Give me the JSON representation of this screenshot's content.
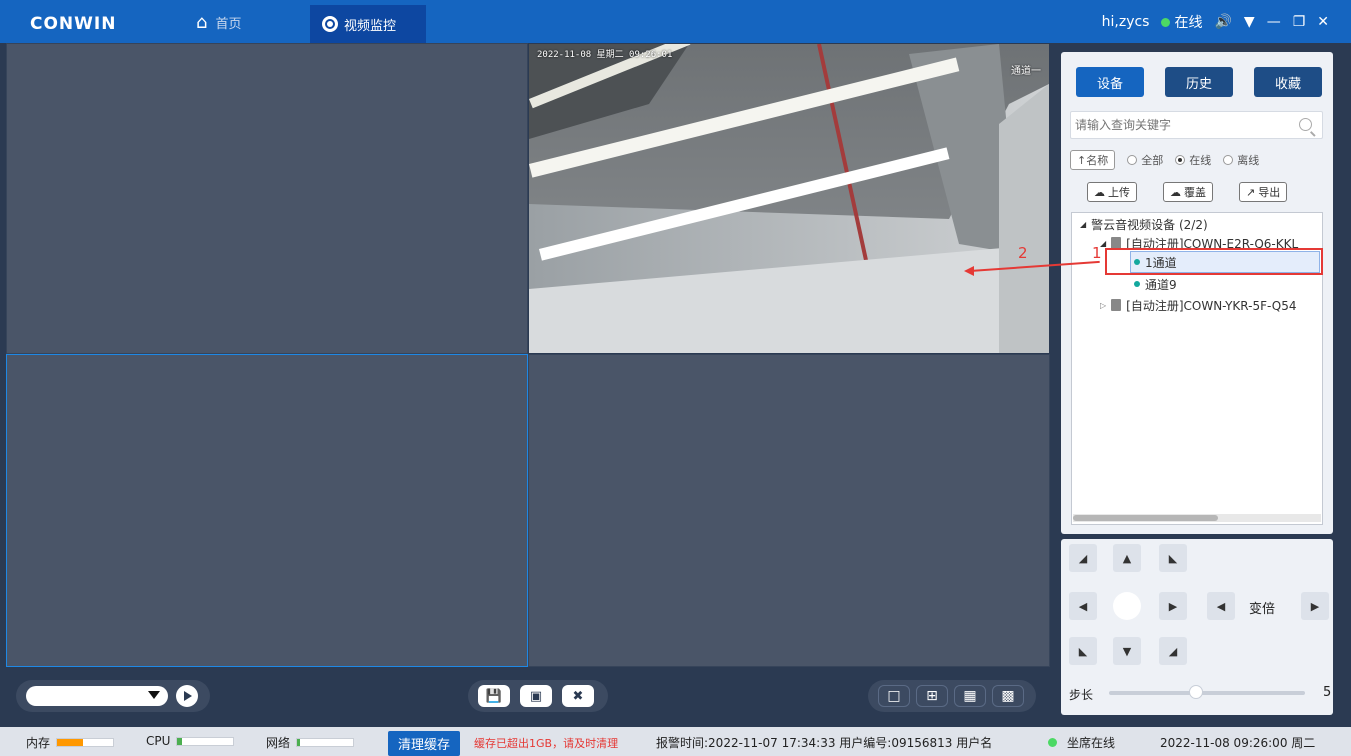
{
  "app": {
    "logo": "CONWIN"
  },
  "nav": {
    "home_label": "首页",
    "monitor_label": "视频监控"
  },
  "window": {
    "user": "hi,zycs",
    "online_status": "在线"
  },
  "camera": {
    "osd_datetime": "2022-11-08 星期二 09:26:01",
    "osd_name": "通道一"
  },
  "toolbar": {
    "channel_select_value": ""
  },
  "sidebar": {
    "tabs": [
      "设备",
      "历史",
      "收藏"
    ],
    "search_placeholder": "请输入查询关键字",
    "sort_label": "↑名称",
    "filters": [
      "全部",
      "在线",
      "离线"
    ],
    "filter_selected": "在线",
    "actions": [
      "上传",
      "覆盖",
      "导出"
    ],
    "tree": {
      "root": "警云音视频设备 (2/2)",
      "device1": "[自动注册]COWN-E2R-Q6-KKL",
      "channel1": "1通道",
      "channel2": "通道9",
      "device2": "[自动注册]COWN-YKR-5F-Q54"
    }
  },
  "annotations": {
    "num1": "1",
    "num2": "2"
  },
  "ptz": {
    "zoom_label": "变倍",
    "step_label": "步长",
    "step_value": "5",
    "step_fraction": 0.45
  },
  "status": {
    "memory_label": "内存",
    "memory_fill": 0.45,
    "cpu_label": "CPU",
    "cpu_fill": 0.08,
    "network_label": "网络",
    "network_fill": 0.05,
    "clear_cache_label": "清理缓存",
    "warning": "缓存已超出1GB，请及时清理",
    "alarm_info": "报警时间:2022-11-07 17:34:33  用户编号:09156813  用户名",
    "seat_status": "坐席在线",
    "datetime": "2022-11-08 09:26:00 周二"
  },
  "colors": {
    "accent": "#1565c0",
    "warning": "#e53935",
    "online": "#4cd964",
    "memory_bar": "#ff9800",
    "cpu_bar": "#4caf50"
  }
}
